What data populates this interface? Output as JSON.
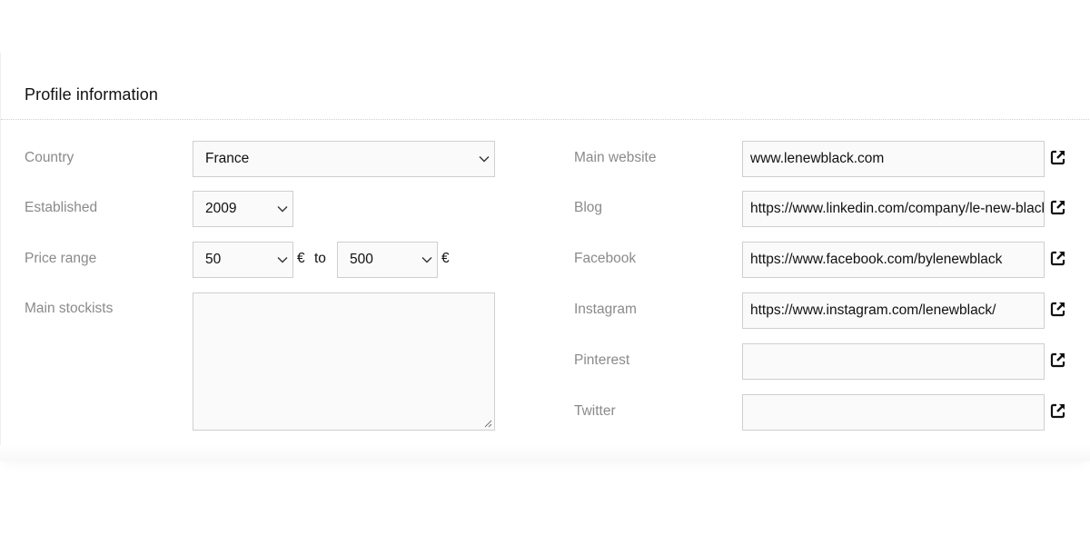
{
  "section": {
    "title": "Profile information"
  },
  "left": {
    "country": {
      "label": "Country",
      "value": "France"
    },
    "established": {
      "label": "Established",
      "value": "2009"
    },
    "price_range": {
      "label": "Price range",
      "min": "50",
      "max": "500",
      "currency": "€",
      "to_text": "to"
    },
    "main_stockists": {
      "label": "Main stockists",
      "value": ""
    }
  },
  "right": {
    "main_website": {
      "label": "Main website",
      "value": "www.lenewblack.com"
    },
    "blog": {
      "label": "Blog",
      "value": "https://www.linkedin.com/company/le-new-black/"
    },
    "facebook": {
      "label": "Facebook",
      "value": "https://www.facebook.com/bylenewblack"
    },
    "instagram": {
      "label": "Instagram",
      "value": "https://www.instagram.com/lenewblack/"
    },
    "pinterest": {
      "label": "Pinterest",
      "value": ""
    },
    "twitter": {
      "label": "Twitter",
      "value": ""
    }
  },
  "icons": {
    "select_chevron": "chevron-down-icon",
    "external_link": "external-link-icon"
  }
}
